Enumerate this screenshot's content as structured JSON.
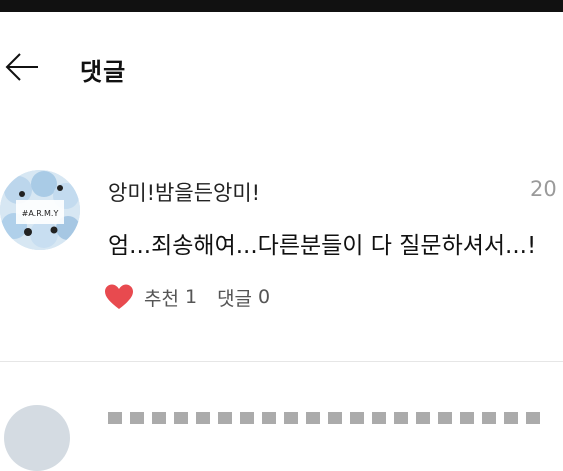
{
  "header": {
    "back_icon": "arrow-left-icon",
    "title": "댓글"
  },
  "comment": {
    "author": "앙미!밤을든앙미!",
    "date": "20",
    "text": "엄...죄송해여...다른분들이 다 질문하셔서...!",
    "like_icon": "heart-icon",
    "like_label": "추천",
    "like_count": "1",
    "reply_label": "댓글",
    "reply_count": "0",
    "avatar_badge": "#A.R.M.Y"
  },
  "colors": {
    "heart": "#e84a4f",
    "date": "#9a9a9a",
    "divider": "#e6e6e6"
  }
}
